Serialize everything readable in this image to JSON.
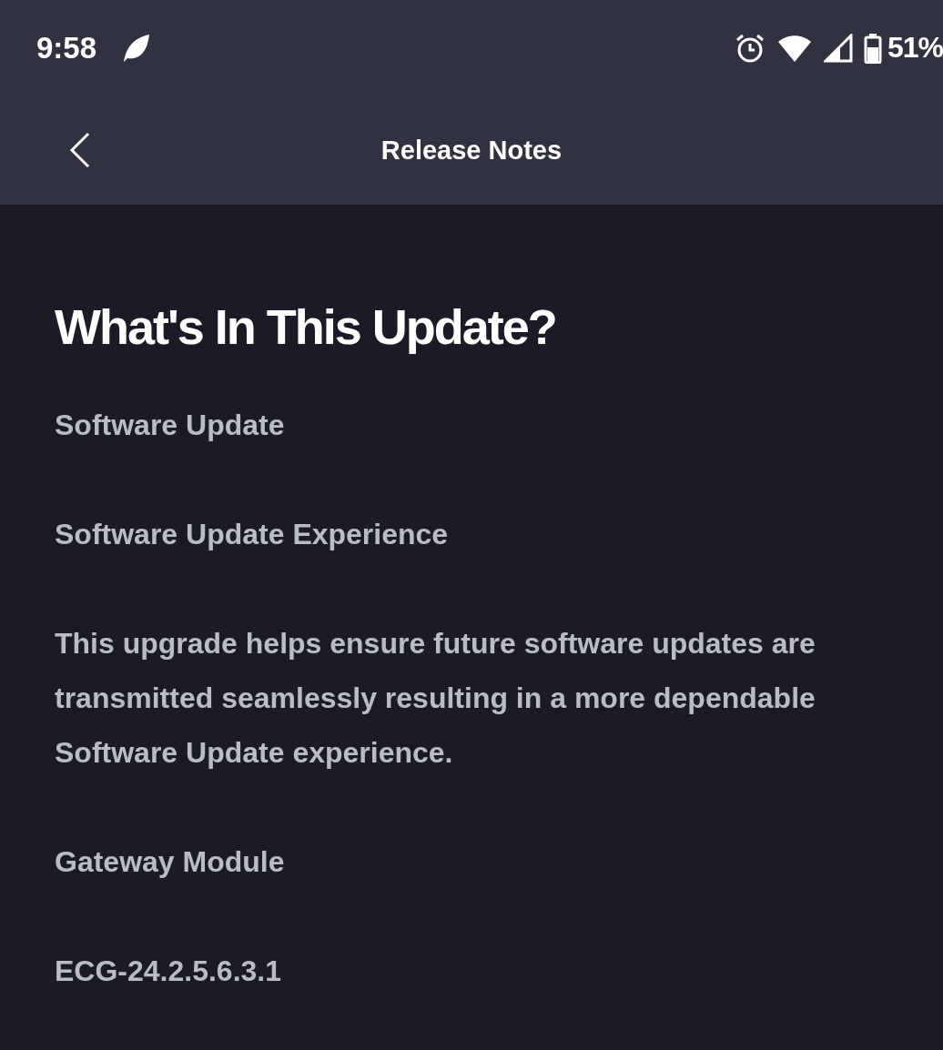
{
  "status_bar": {
    "time": "9:58",
    "battery": "51%"
  },
  "header": {
    "title": "Release Notes"
  },
  "content": {
    "heading": "What's In This Update?",
    "paragraphs": [
      "Software Update",
      "Software Update Experience",
      "This upgrade helps ensure future software updates are transmitted seamlessly resulting in a more dependable Software Update experience.",
      "Gateway Module",
      "ECG-24.2.5.6.3.1"
    ]
  }
}
